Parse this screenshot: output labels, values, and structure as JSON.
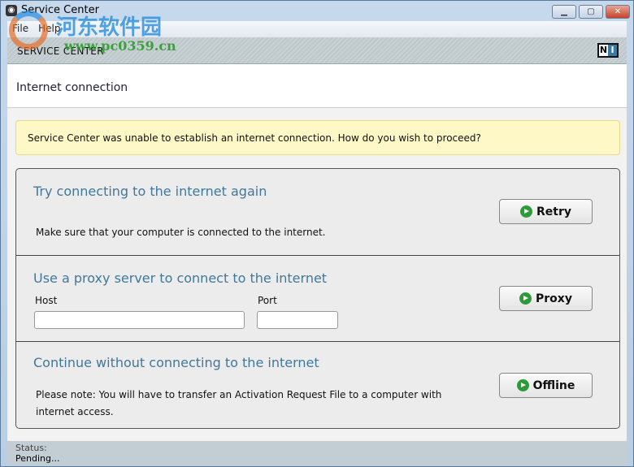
{
  "window": {
    "title": "Service Center",
    "minimize": "▁",
    "maximize": "▢",
    "close": "✕"
  },
  "menu": [
    "File",
    "Help"
  ],
  "brand": {
    "title": "SERVICE CENTER",
    "logo": [
      "N",
      "I"
    ]
  },
  "page": {
    "heading": "Internet connection"
  },
  "notice": "Service Center was unable to establish an internet connection. How do you wish to proceed?",
  "sections": {
    "retry": {
      "title": "Try connecting to the internet again",
      "text": "Make sure that your computer is connected to the internet.",
      "button": "Retry"
    },
    "proxy": {
      "title": "Use a proxy server to connect to the internet",
      "host_label": "Host",
      "host_value": "",
      "port_label": "Port",
      "port_value": "",
      "button": "Proxy"
    },
    "offline": {
      "title": "Continue without connecting to the internet",
      "text": "Please note: You will have to transfer an Activation Request File to a computer with internet access.",
      "button": "Offline"
    }
  },
  "status": {
    "label": "Status:",
    "value": "Pending..."
  },
  "watermark": {
    "text": "河东软件园",
    "url": "www.pc0359.cn"
  },
  "colors": {
    "accent": "#40789a",
    "notice_bg": "#fdf8c6",
    "button_icon": "#2e9a3a"
  }
}
